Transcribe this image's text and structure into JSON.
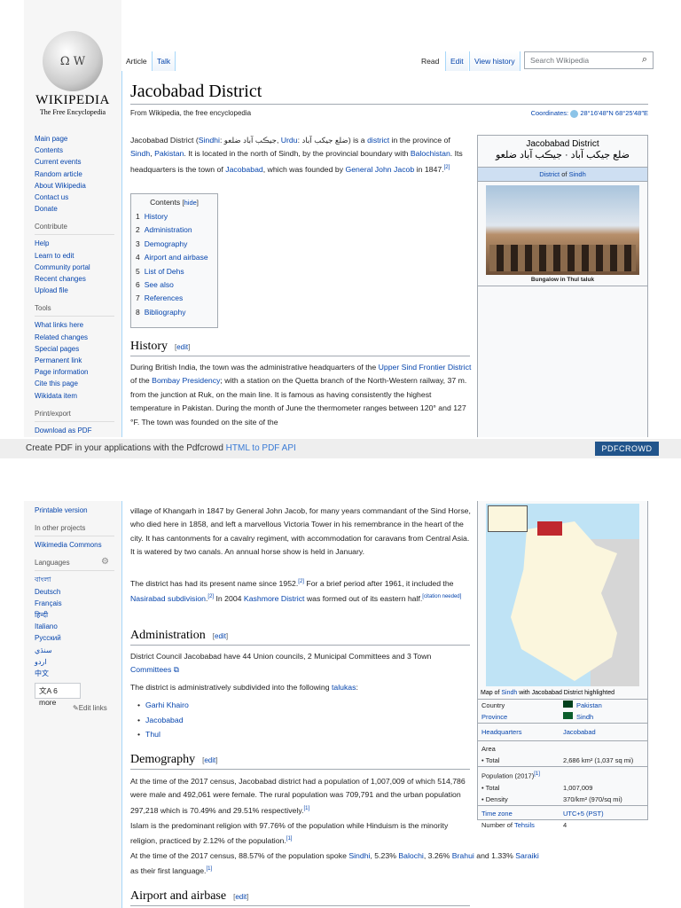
{
  "logo": {
    "wordmark": "WIKIPEDIA",
    "tagline": "The Free Encyclopedia"
  },
  "nav": {
    "main": [
      "Main page",
      "Contents",
      "Current events",
      "Random article",
      "About Wikipedia",
      "Contact us",
      "Donate"
    ],
    "contribute_h": "Contribute",
    "contribute": [
      "Help",
      "Learn to edit",
      "Community portal",
      "Recent changes",
      "Upload file"
    ],
    "tools_h": "Tools",
    "tools": [
      "What links here",
      "Related changes",
      "Special pages",
      "Permanent link",
      "Page information",
      "Cite this page",
      "Wikidata item"
    ],
    "print_h": "Print/export",
    "print": [
      "Download as PDF"
    ],
    "print2": [
      "Printable version"
    ],
    "other_h": "In other projects",
    "other": [
      "Wikimedia Commons"
    ],
    "lang_h": "Languages",
    "langs": [
      "বাংলা",
      "Deutsch",
      "Français",
      "हिन्दी",
      "Italiano",
      "Русский",
      "سنڌي",
      "اردو",
      "中文"
    ],
    "more": "6 more",
    "edit_links": "Edit links"
  },
  "tabs": {
    "article": "Article",
    "talk": "Talk",
    "read": "Read",
    "edit": "Edit",
    "history": "View history"
  },
  "search": {
    "placeholder": "Search Wikipedia"
  },
  "title": "Jacobabad District",
  "subtitle": "From Wikipedia, the free encyclopedia",
  "coordinates": {
    "label": "Coordinates:",
    "value": "28°16′48″N 68°25′48″E"
  },
  "intro": [
    {
      "t": "Jacobabad District ("
    },
    {
      "t": "Sindhi",
      "l": 1
    },
    {
      "t": ": جيڪب آباد ضلعو, "
    },
    {
      "t": "Urdu",
      "l": 1
    },
    {
      "t": ": ضلع جیکب آباد) is a "
    },
    {
      "t": "district",
      "l": 1
    },
    {
      "t": " in the province of "
    },
    {
      "t": "Sindh",
      "l": 1
    },
    {
      "t": ", "
    },
    {
      "t": "Pakistan",
      "l": 1
    },
    {
      "t": ". It is located in the north of Sindh, by the provincial boundary with "
    },
    {
      "t": "Balochistan",
      "l": 1
    },
    {
      "t": ". Its headquarters is the town of "
    },
    {
      "t": "Jacobabad",
      "l": 1
    },
    {
      "t": ", which was founded by "
    },
    {
      "t": "General John Jacob",
      "l": 1
    },
    {
      "t": " in 1847."
    },
    {
      "t": "[2]",
      "s": 1
    }
  ],
  "toc": {
    "title": "Contents",
    "hide": "hide",
    "items": [
      [
        "1",
        "History"
      ],
      [
        "2",
        "Administration"
      ],
      [
        "3",
        "Demography"
      ],
      [
        "4",
        "Airport and airbase"
      ],
      [
        "5",
        "List of Dehs"
      ],
      [
        "6",
        "See also"
      ],
      [
        "7",
        "References"
      ],
      [
        "8",
        "Bibliography"
      ]
    ]
  },
  "sections": {
    "history": "History",
    "administration": "Administration",
    "demography": "Demography",
    "airport": "Airport and airbase",
    "edit": "edit"
  },
  "history_p1": [
    {
      "t": "During British India, the town was the administrative headquarters of the "
    },
    {
      "t": "Upper Sind Frontier District",
      "l": 1
    },
    {
      "t": " of the "
    },
    {
      "t": "Bombay Presidency",
      "l": 1
    },
    {
      "t": "; with a station on the Quetta branch of the North-Western railway, 37 m. from the junction at Ruk, on the main line. It is famous as having consistently the highest temperature in Pakistan. During the month of June the thermometer ranges between 120° and 127 °F. The town was founded on the site of the"
    }
  ],
  "history_p1b": [
    {
      "t": "village of Khangarh in 1847 by General John Jacob, for many years commandant of the Sind Horse, who died here in 1858, and left a marvellous Victoria Tower in his remembrance in the heart of the city. It has cantonments for a cavalry regiment, with accommodation for caravans from Central Asia. It is watered by two canals. An annual horse show is held in January."
    }
  ],
  "history_p2": [
    {
      "t": "The district has had its present name since 1952."
    },
    {
      "t": "[2]",
      "s": 1
    },
    {
      "t": " For a brief period after 1961, it included the "
    },
    {
      "t": "Nasirabad subdivision",
      "l": 1
    },
    {
      "t": "."
    },
    {
      "t": "[2]",
      "s": 1
    },
    {
      "t": " In 2004 "
    },
    {
      "t": "Kashmore District",
      "l": 1
    },
    {
      "t": " was formed out of its eastern half."
    },
    {
      "t": "[citation needed]",
      "s": 1
    }
  ],
  "admin_p1": [
    {
      "t": "District Council Jacobabad have 44 Union councils, 2 Municipal Committees and 3 Town "
    },
    {
      "t": "Committees ⧉",
      "l": 1
    }
  ],
  "admin_p2": [
    {
      "t": "The district is administratively subdivided into the following "
    },
    {
      "t": "talukas",
      "l": 1
    },
    {
      "t": ":"
    }
  ],
  "talukas": [
    "Garhi Khairo",
    "Jacobabad",
    "Thul"
  ],
  "demo_p1": [
    {
      "t": "At the time of the 2017 census, Jacobabad district had a population of 1,007,009 of which 514,786 were male and 492,061 were female. The rural population was 709,791 and the urban population 297,218 which is 70.49% and 29.51% respectively."
    },
    {
      "t": "[1]",
      "s": 1
    }
  ],
  "demo_p2": [
    {
      "t": "Islam is the predominant religion with 97.76% of the population while Hinduism is the minority religion, practiced by 2.12% of the population."
    },
    {
      "t": "[1]",
      "s": 1
    }
  ],
  "demo_p3": [
    {
      "t": "At the time of the 2017 census, 88.57% of the population spoke "
    },
    {
      "t": "Sindhi",
      "l": 1
    },
    {
      "t": ", 5.23% "
    },
    {
      "t": "Balochi",
      "l": 1
    },
    {
      "t": ", 3.26% "
    },
    {
      "t": "Brahui",
      "l": 1
    },
    {
      "t": " and 1.33% "
    },
    {
      "t": "Saraiki",
      "l": 1
    },
    {
      "t": " as their first language."
    },
    {
      "t": "[1]",
      "s": 1
    }
  ],
  "infobox": {
    "name": "Jacobabad District",
    "native": "ضلع جیکب آباد · جيڪب آباد ضلعو",
    "type_pre": "District",
    "type_mid": " of ",
    "type_link": "Sindh",
    "image_caption": "Bungalow in Thul taluk",
    "map_caption_pre": "Map of ",
    "map_caption_link": "Sindh",
    "map_caption_post": " with Jacobabad District highlighted",
    "country_k": "Country",
    "country_v": "Pakistan",
    "province_k": "Province",
    "province_v": "Sindh",
    "hq_k": "Headquarters",
    "hq_v": "Jacobabad",
    "area_k": "Area",
    "area_total_k": "• Total",
    "area_total_v": "2,686 km² (1,037 sq mi)",
    "pop_k": "Population (2017)",
    "pop_ref": "[1]",
    "pop_total_k": "• Total",
    "pop_total_v": "1,007,009",
    "density_k": "• Density",
    "density_v": "370/km² (970/sq mi)",
    "tz_k": "Time zone",
    "tz_v": "UTC+5 (PST)",
    "tehsils_k_pre": "Number of ",
    "tehsils_k_link": "Tehsils",
    "tehsils_v": "4"
  },
  "pdfcrowd": {
    "text": "Create PDF in your applications with the Pdfcrowd ",
    "link": "HTML to PDF API",
    "button": "PDFCROWD"
  },
  "colors": {
    "link": "#0645ad",
    "border": "#a2a9b1",
    "highlight": "#c0282e",
    "pdfbutton": "#21548b"
  }
}
